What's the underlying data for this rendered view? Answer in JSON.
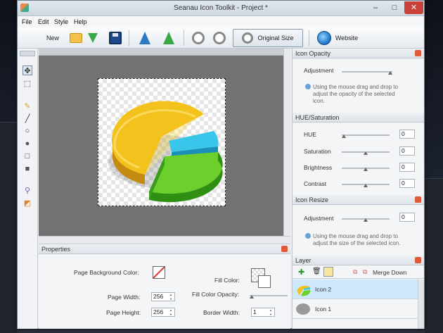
{
  "window": {
    "title": "Seanau Icon Toolkit - Project *"
  },
  "menu": {
    "items": [
      "File",
      "Edit",
      "Style",
      "Help"
    ]
  },
  "toolbar": {
    "new_label": "New",
    "original_size_label": "Original Size",
    "website_label": "Website"
  },
  "properties": {
    "title": "Properties",
    "page_bg_color_label": "Page Background Color:",
    "page_width_label": "Page Width:",
    "page_width_value": "256",
    "page_height_label": "Page Height:",
    "page_height_value": "256",
    "fill_color_label": "Fill Color:",
    "fill_opacity_label": "Fill Color Opacity:",
    "border_width_label": "Border Width:",
    "border_width_value": "1"
  },
  "icon_opacity": {
    "title": "Icon Opacity",
    "adjustment_label": "Adjustment",
    "hint_line1": "Using the mouse drag and drop to",
    "hint_line2": "adjust the opacity of the selected",
    "hint_line3": "icon."
  },
  "hue_saturation": {
    "title": "HUE/Saturation",
    "rows": [
      {
        "label": "HUE",
        "value": "0"
      },
      {
        "label": "Saturation",
        "value": "0"
      },
      {
        "label": "Brightness",
        "value": "0"
      },
      {
        "label": "Contrast",
        "value": "0"
      }
    ]
  },
  "icon_resize": {
    "title": "Icon Resize",
    "adjustment_label": "Adjustment",
    "adjustment_value": "0",
    "hint_line1": "Using the mouse drag and drop to",
    "hint_line2": "adjust the size of the selected icon."
  },
  "layer": {
    "title": "Layer",
    "merge_down_label": "Merge Down",
    "items": [
      {
        "name": "Icon 2"
      },
      {
        "name": "Icon 1"
      }
    ]
  },
  "colors": {
    "accent": "#cfe7fb",
    "close": "#c8423a",
    "canvas": "#727272"
  },
  "icons": [
    "new-icon",
    "open-folder-icon",
    "import-icon",
    "save-icon",
    "export-blue-icon",
    "export-green-icon",
    "zoom-in-icon",
    "zoom-out-icon",
    "original-size-icon",
    "globe-icon",
    "move-tool-icon",
    "select-tool-icon",
    "pencil-icon",
    "line-icon",
    "ellipse-icon",
    "filled-ellipse-icon",
    "rectangle-icon",
    "filled-rectangle-icon",
    "eyedropper-icon",
    "eraser-icon",
    "add-icon",
    "delete-icon",
    "lock-icon",
    "duplicate-icon",
    "merge-icon"
  ]
}
